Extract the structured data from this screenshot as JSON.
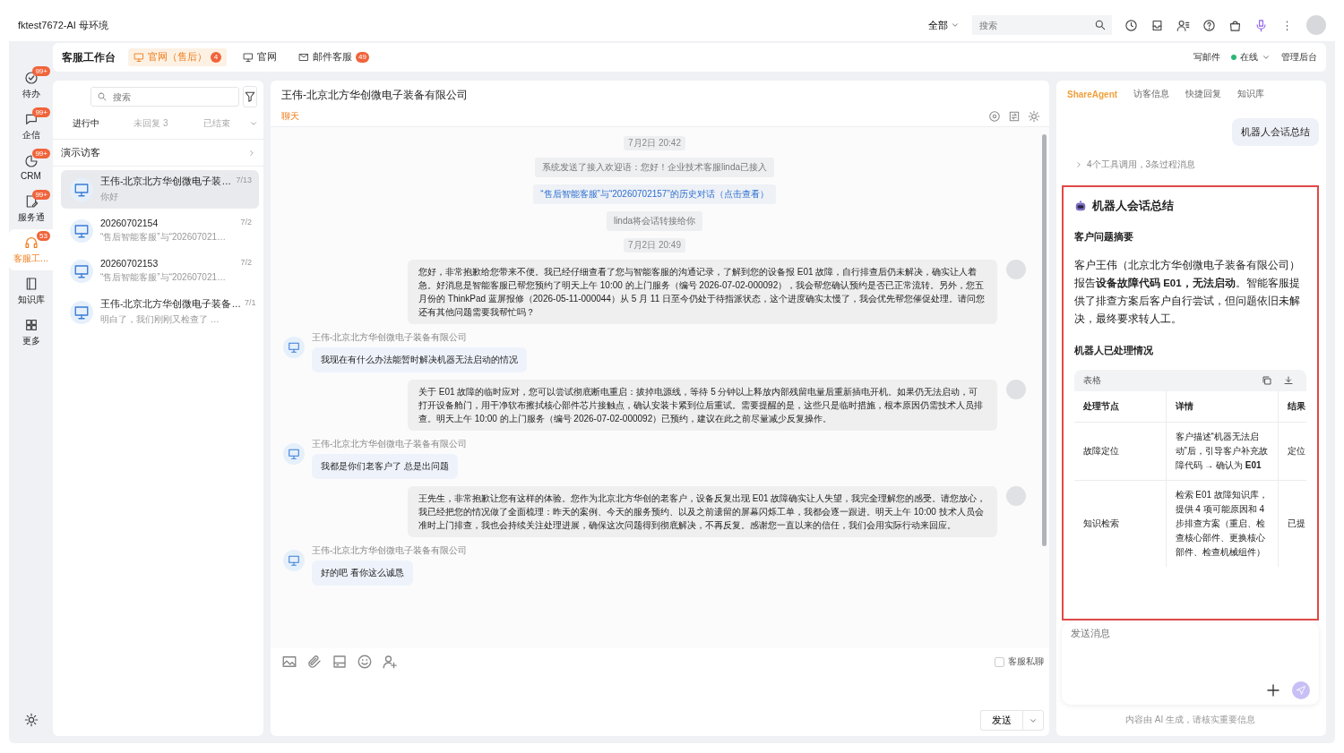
{
  "window": {
    "title": "fktest7672-AI 母环境"
  },
  "topbar": {
    "scope": "全部",
    "search_placeholder": "搜索"
  },
  "workspace": {
    "title": "客服工作台",
    "tabs": [
      {
        "label": "官网（售后）",
        "badge": "4",
        "selected": true
      },
      {
        "label": "官网",
        "selected": false
      },
      {
        "label": "邮件客服",
        "badge": "49",
        "selected": false
      }
    ],
    "compose": "写邮件",
    "status": "在线",
    "admin": "管理后台"
  },
  "rail": [
    {
      "label": "待办",
      "badge": "99+",
      "selected": false
    },
    {
      "label": "企信",
      "badge": "99+",
      "selected": false
    },
    {
      "label": "CRM",
      "badge": "99+",
      "selected": false
    },
    {
      "label": "服务通",
      "badge": "99+",
      "selected": false
    },
    {
      "label": "客服工…",
      "badge": "53",
      "selected": true
    },
    {
      "label": "知识库",
      "selected": false
    },
    {
      "label": "更多",
      "selected": false
    }
  ],
  "conversations": {
    "search_placeholder": "搜索",
    "filters": [
      {
        "label": "进行中",
        "selected": true
      },
      {
        "label": "未回复 3",
        "selected": false
      },
      {
        "label": "已结束",
        "selected": false
      }
    ],
    "group": "演示访客",
    "items": [
      {
        "name": "王伟-北京北方华创微电子装…",
        "preview": "你好",
        "date": "7/13",
        "selected": true
      },
      {
        "name": "20260702154",
        "preview": "“售后智能客服”与“202607021…",
        "date": "7/2",
        "selected": false
      },
      {
        "name": "20260702153",
        "preview": "“售后智能客服”与“202607021…",
        "date": "7/2",
        "selected": false
      },
      {
        "name": "王伟-北京北方华创微电子装备…",
        "preview": "明白了，我们刚刚又检查了 …",
        "date": "7/1",
        "selected": false
      }
    ]
  },
  "chat": {
    "title": "王伟-北京北方华创微电子装备有限公司",
    "tab": "聊天",
    "messages": [
      {
        "kind": "time",
        "text": "7月2日 20:42"
      },
      {
        "kind": "system",
        "text": "系统发送了接入欢迎语：您好！企业技术客服linda已接入"
      },
      {
        "kind": "link",
        "text": "“售后智能客服”与“20260702157”的历史对话（点击查看）"
      },
      {
        "kind": "system",
        "text": "linda将会话转接给你"
      },
      {
        "kind": "time",
        "text": "7月2日 20:49"
      },
      {
        "kind": "agent",
        "text": "您好，非常抱歉给您带来不便。我已经仔细查看了您与智能客服的沟通记录，了解到您的设备报 E01 故障，自行排查后仍未解决，确实让人着急。好消息是智能客服已帮您预约了明天上午 10:00 的上门服务（编号 2026-07-02-000092），我会帮您确认预约是否已正常流转。另外，您五月份的 ThinkPad 蓝屏报修（2026-05-11-000044）从 5 月 11 日至今仍处于待指派状态，这个进度确实太慢了，我会优先帮您催促处理。请问您还有其他问题需要我帮忙吗？"
      },
      {
        "kind": "customer",
        "sender": "王伟-北京北方华创微电子装备有限公司",
        "text": "我现在有什么办法能暂时解决机器无法启动的情况"
      },
      {
        "kind": "agent",
        "text": "关于 E01 故障的临时应对，您可以尝试彻底断电重启：拔掉电源线，等待 5 分钟以上释放内部残留电量后重新插电开机。如果仍无法启动，可打开设备舱门，用干净软布擦拭核心部件芯片接触点，确认安装卡紧到位后重试。需要提醒的是，这些只是临时措施，根本原因仍需技术人员排查。明天上午 10:00 的上门服务（编号 2026-07-02-000092）已预约，建议在此之前尽量减少反复操作。"
      },
      {
        "kind": "customer",
        "sender": "王伟-北京北方华创微电子装备有限公司",
        "text": "我都是你们老客户了 总是出问题"
      },
      {
        "kind": "agent",
        "text": "王先生，非常抱歉让您有这样的体验。您作为北京北方华创的老客户，设备反复出现 E01 故障确实让人失望，我完全理解您的感受。请您放心，我已经把您的情况做了全面梳理：昨天的案例、今天的服务预约、以及之前遗留的屏幕闪烁工单，我都会逐一跟进。明天上午 10:00 技术人员会准时上门排查，我也会持续关注处理进展，确保这次问题得到彻底解决，不再反复。感谢您一直以来的信任，我们会用实际行动来回应。"
      },
      {
        "kind": "customer",
        "sender": "王伟-北京北方华创微电子装备有限公司",
        "text": "好的吧 看你这么诚恳"
      }
    ],
    "private_label": "客服私聊",
    "private_checked": false,
    "send": "发送"
  },
  "assistant": {
    "tabs": [
      {
        "label": "ShareAgent",
        "selected": true
      },
      {
        "label": "访客信息",
        "selected": false
      },
      {
        "label": "快捷回复",
        "selected": false
      },
      {
        "label": "知识库",
        "selected": false
      }
    ],
    "prompt": "机器人会话总结",
    "steps": "4个工具调用，3条过程消息",
    "card": {
      "title": "机器人会话总结",
      "summary_heading": "客户问题摘要",
      "summary": "客户王伟（北京北方华创微电子装备有限公司）报告**设备故障代码 E01，无法启动**。智能客服提供了排查方案后客户自行尝试，但问题依旧未解决，最终要求转人工。",
      "handled_heading": "机器人已处理情况",
      "table": {
        "title": "表格",
        "columns": [
          "处理节点",
          "详情",
          "结果"
        ],
        "rows": [
          [
            "故障定位",
            "客户描述“机器无法启动”后，引导客户补充故障代码 → 确认为 **E01**",
            "定位"
          ],
          [
            "知识检索",
            "检索 E01 故障知识库，提供 4 项可能原因和 4 步排查方案（重启、检查核心部件、更换核心部件、检查机械组件）",
            "已提"
          ]
        ]
      }
    },
    "input_placeholder": "发送消息",
    "footer": "内容由 AI 生成，请核实重要信息"
  }
}
